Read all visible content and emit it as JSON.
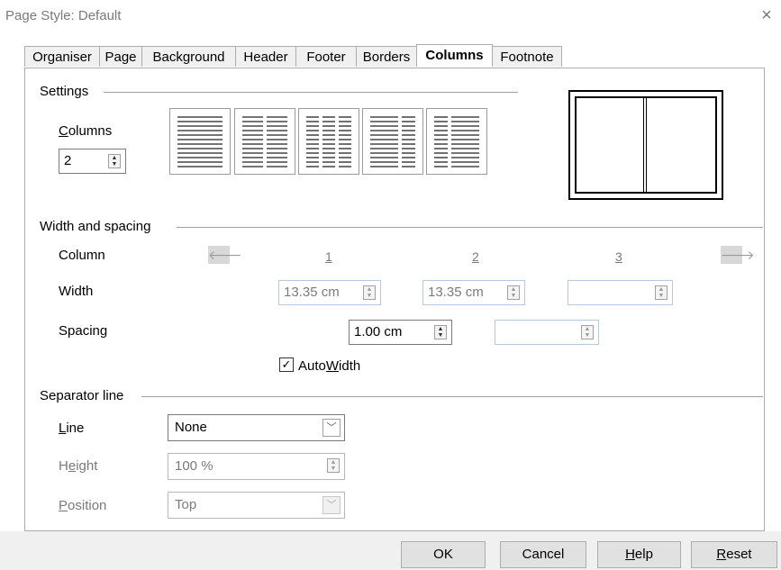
{
  "window": {
    "title": "Page Style: Default",
    "close_glyph": "×"
  },
  "tabs": [
    {
      "label": "Organiser"
    },
    {
      "label": "Page"
    },
    {
      "label": "Background"
    },
    {
      "label": "Header"
    },
    {
      "label": "Footer"
    },
    {
      "label": "Borders"
    },
    {
      "label": "Columns",
      "active": true
    },
    {
      "label": "Footnote"
    }
  ],
  "settings": {
    "section_title": "Settings",
    "columns_label_first": "C",
    "columns_label_rest": "olumns",
    "columns_value": "2",
    "layouts": [
      "one-column-layout",
      "two-columns-layout",
      "three-columns-layout",
      "left-wide-layout",
      "right-wide-layout"
    ]
  },
  "width_spacing": {
    "section_title": "Width and spacing",
    "column_label": "Column",
    "width_label": "Width",
    "spacing_label": "Spacing",
    "col_numbers": [
      "1",
      "2",
      "3"
    ],
    "widths": [
      "13.35 cm",
      "13.35 cm",
      ""
    ],
    "spacings": [
      "1.00 cm",
      ""
    ],
    "autowidth_checked": true,
    "autowidth_pre": "Auto",
    "autowidth_u": "W",
    "autowidth_post": "idth",
    "left_arrow": "🡐",
    "right_arrow": "🡒"
  },
  "separator": {
    "section_title": "Separator line",
    "line_label_u": "L",
    "line_label_rest": "ine",
    "line_value": "None",
    "height_label_pre": "H",
    "height_label_u": "e",
    "height_label_post": "ight",
    "height_value": "100 %",
    "position_label_u": "P",
    "position_label_rest": "osition",
    "position_value": "Top"
  },
  "buttons": {
    "ok": "OK",
    "cancel": "Cancel",
    "help_u": "H",
    "help_rest": "elp",
    "reset_u": "R",
    "reset_rest": "eset"
  },
  "icons": {
    "spin_up": "▲",
    "spin_down": "▼",
    "dropdown": "﹀",
    "check": "✓"
  }
}
